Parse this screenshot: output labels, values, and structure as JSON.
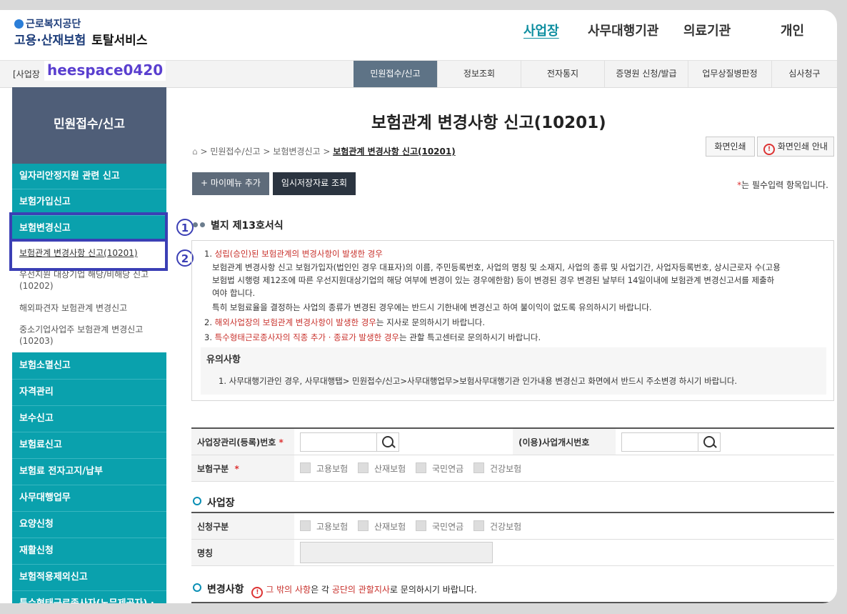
{
  "header": {
    "org": "근로복지공단",
    "service_main": "고용·산재보험",
    "service_sub": "토탈서비스",
    "nav": [
      "사업장",
      "사무대행기관",
      "의료기관",
      "개인"
    ]
  },
  "gnb": {
    "label": "[사업장",
    "watermark": "heespace0420",
    "tabs": [
      "민원접수/신고",
      "정보조회",
      "전자통지",
      "증명원 신청/발급",
      "업무상질병판정",
      "심사청구"
    ]
  },
  "sidebar": {
    "title": "민원접수/신고",
    "items_top": [
      "일자리안정지원 관련 신고",
      "보험가입신고",
      "보험변경신고"
    ],
    "subitems": [
      "보험관계 변경사항 신고(10201)",
      "우선지원 대상기업 해당/비해당 신고 (10202)",
      "해외파견자 보험관계 변경신고",
      "중소기업사업주 보험관계 변경신고 (10203)"
    ],
    "items_bottom": [
      "보험소멸신고",
      "자격관리",
      "보수신고",
      "보험료신고",
      "보험료 전자고지/납부",
      "사무대행업무",
      "요양신청",
      "재활신청",
      "보험적용제외신고",
      "특수형태근로종사자(노무제공자) ·"
    ],
    "markers": [
      "1",
      "2"
    ]
  },
  "main": {
    "title": "보험관계 변경사항 신고(10201)",
    "breadcrumb": [
      "민원접수/신고",
      "보험변경신고",
      "보험관계 변경사항 신고(10201)"
    ],
    "print_btn": "화면인쇄",
    "print_guide_btn": "화면인쇄 안내",
    "mymenu_btn": "+ 마이메뉴 추가",
    "temp_btn": "임시저장자료 조회",
    "req_note_star": "*",
    "req_note": "는 필수입력 항목입니다.",
    "form_title": "별지 제13호서식",
    "notices": {
      "n1_num": "1.",
      "n1_head": "성립(승인)된 보험관계의 변경사항이 발생한 경우",
      "n1_l1": "보험관계 변경사항 신고 보험가입자(법인인 경우 대표자)의 이름, 주민등록번호, 사업의 명칭 및 소재지, 사업의 종류 및 사업기간, 사업자등록번호, 상시근로자 수(고용",
      "n1_l2": "보험법 시행령 제12조에 따른 우선지원대상기업의 해당 여부에 변경이 있는 경우에한함) 등이 변경된 경우 변경된 날부터 14일이내에 보험관계 변경신고서를 제출하",
      "n1_l3": "여야 합니다.",
      "n1_l4": "특히 보험료율을 결정하는 사업의 종류가 변경된 경우에는 반드시 기한내에 변경신고 하여 불이익이 없도록 유의하시기 바랍니다.",
      "n2_num": "2.",
      "n2_head": "해외사업장의 보험관계 변경사항이 발생한 경우",
      "n2_tail": "는 지사로 문의하시기 바랍니다.",
      "n3_num": "3.",
      "n3_head": "특수형태근로종사자의 직종 추가 · 종료가 발생한 경우",
      "n3_tail": "는 관할 특고센터로 문의하시기 바랍니다."
    },
    "caution_title": "유의사항",
    "caution_text": "1. 사무대행기관인 경우, 사무대행탭> 민원접수/신고>사무대행업무>보험사무대행기관 인가내용 변경신고 화면에서 반드시 주소변경 하시기 바랍니다.",
    "form": {
      "reg_no_label": "사업장관리(등록)번호",
      "start_no_label": "(이용)사업개시번호",
      "ins_type_label": "보험구분",
      "req_star": "*",
      "checks": [
        "고용보험",
        "산재보험",
        "국민연금",
        "건강보험"
      ]
    },
    "section_biz": "사업장",
    "biz_form": {
      "apply_type_label": "신청구분",
      "name_label": "명칭"
    },
    "section_change": "변경사항",
    "change_note_alert": "!",
    "change_note_a": "그 밖의 사항",
    "change_note_b": "은 각",
    "change_note_c": "공단의 관할지사",
    "change_note_d": "로 문의하시기 바랍니다."
  },
  "colors": {
    "accent": "#0aa1ad",
    "sidebar_head": "#4f5e78",
    "highlight": "#3b3fb5",
    "warning": "#c8302b"
  }
}
